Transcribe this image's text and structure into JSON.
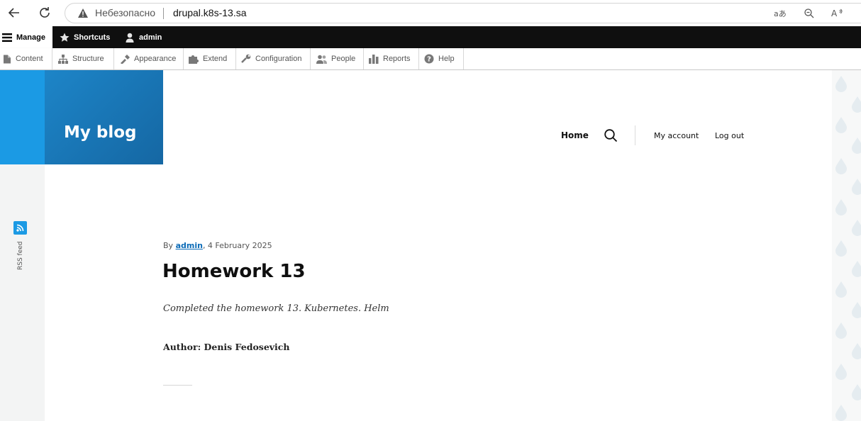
{
  "browser": {
    "insecure_label": "Небезопасно",
    "url": "drupal.k8s-13.sa"
  },
  "toolbar": {
    "manage": "Manage",
    "shortcuts": "Shortcuts",
    "user": "admin"
  },
  "tray": {
    "items": [
      "Content",
      "Structure",
      "Appearance",
      "Extend",
      "Configuration",
      "People",
      "Reports",
      "Help"
    ]
  },
  "site": {
    "name": "My blog",
    "nav_home": "Home",
    "nav_account": "My account",
    "nav_logout": "Log out"
  },
  "feed": {
    "label": "RSS feed"
  },
  "article": {
    "by": "By ",
    "author": "admin",
    "date": ", 4 February 2025",
    "title": "Homework 13",
    "summary": "Completed the homework 13. Kubernetes. Helm",
    "author_line": "Author: Denis Fedosevich"
  },
  "colors": {
    "accent": "#1b9ae4",
    "brand_dark": "#1567a3",
    "toolbar": "#0f0f0f"
  }
}
